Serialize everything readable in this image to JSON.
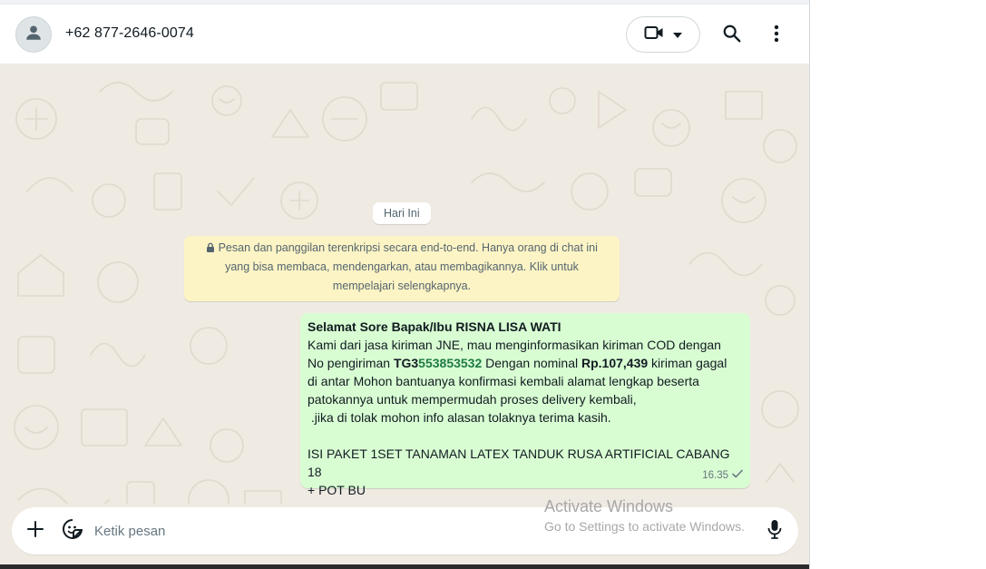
{
  "header": {
    "contact_name": "+62 877-2646-0074",
    "avatar_icon": "person-icon",
    "video_call_icon": "video-camera-icon",
    "dropdown_icon": "caret-down-icon",
    "search_icon": "search-icon",
    "menu_icon": "more-vertical-icon"
  },
  "chat": {
    "date_chip": "Hari Ini",
    "encryption_notice": {
      "icon": "lock-icon",
      "text": "Pesan dan panggilan terenkripsi secara end-to-end. Hanya orang di chat ini yang bisa membaca, mendengarkan, atau membagikannya. Klik untuk mempelajari selengkapnya."
    },
    "message": {
      "greeting": "Selamat Sore Bapak/Ibu RISNA LISA WATI",
      "line1": "Kami dari jasa kiriman JNE, mau menginformasikan kiriman COD dengan",
      "no_pengiriman_label": "No pengiriman ",
      "track_prefix": "TG3",
      "track_number": "553853532",
      "nominal_label": " Dengan nominal ",
      "amount": "Rp.107,439",
      "after_amount": " kiriman gagal",
      "line3": "di antar Mohon bantuanya konfirmasi kembali alamat lengkap beserta",
      "line4": "patokannya untuk mempermudah proses delivery kembali,",
      "line5": " .jika di tolak mohon info alasan tolaknya terima kasih.",
      "line6": "ISI PAKET 1SET TANAMAN LATEX TANDUK RUSA ARTIFICIAL CABANG 18",
      "line7": "+ POT BU",
      "time": "16.35",
      "status_icon": "single-check-icon"
    }
  },
  "composer": {
    "plus_icon": "plus-icon",
    "sticker_icon": "sticker-icon",
    "placeholder": "Ketik pesan",
    "mic_icon": "microphone-icon"
  },
  "watermark": {
    "title": "Activate Windows",
    "subtitle": "Go to Settings to activate Windows."
  },
  "colors": {
    "outgoing_bubble": "#d9fdd3",
    "chat_background": "#efeae2",
    "notice_background": "#fdf4c5",
    "tracking_number": "#1f7a45"
  }
}
